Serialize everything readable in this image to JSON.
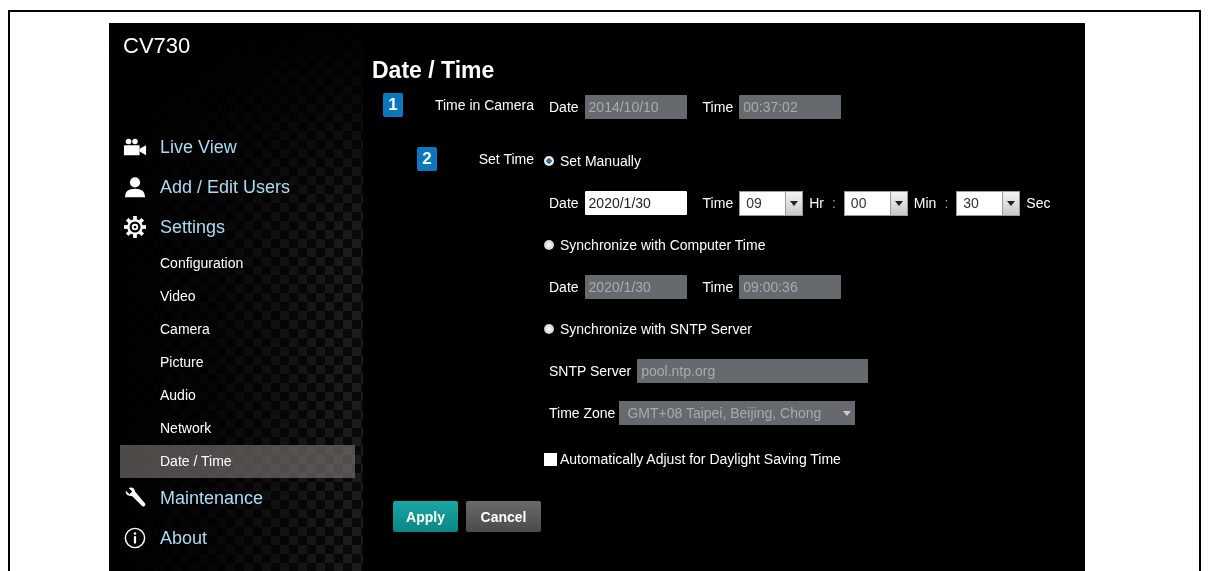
{
  "app": {
    "model": "CV730"
  },
  "sidebar": {
    "items": [
      {
        "label": "Live View"
      },
      {
        "label": "Add / Edit Users"
      },
      {
        "label": "Settings",
        "children": [
          {
            "label": "Configuration",
            "selected": false
          },
          {
            "label": "Video",
            "selected": false
          },
          {
            "label": "Camera",
            "selected": false
          },
          {
            "label": "Picture",
            "selected": false
          },
          {
            "label": "Audio",
            "selected": false
          },
          {
            "label": "Network",
            "selected": false
          },
          {
            "label": "Date / Time",
            "selected": true
          }
        ]
      },
      {
        "label": "Maintenance"
      },
      {
        "label": "About"
      }
    ]
  },
  "page": {
    "title": "Date / Time",
    "time_in_camera": {
      "number": "1",
      "label": "Time in Camera",
      "date_label": "Date",
      "date": "2014/10/10",
      "time_label": "Time",
      "time": "00:37:02"
    },
    "set_time": {
      "number": "2",
      "label": "Set Time",
      "options": [
        {
          "kind": "manual",
          "label": "Set Manually",
          "selected": true,
          "date_label": "Date",
          "date": "2020/1/30",
          "time_label": "Time",
          "time_parts": [
            {
              "value": "09",
              "unit": "Hr",
              "separator": ":"
            },
            {
              "value": "00",
              "unit": "Min",
              "separator": ":"
            },
            {
              "value": "30",
              "unit": "Sec"
            }
          ]
        },
        {
          "kind": "computer",
          "label": "Synchronize with Computer Time",
          "selected": false,
          "date_label": "Date",
          "date": "2020/1/30",
          "time_label": "Time",
          "time": "09:00:36"
        },
        {
          "kind": "sntp",
          "label": "Synchronize with SNTP Server",
          "selected": false,
          "server_label": "SNTP Server",
          "server": "pool.ntp.org",
          "zone_label": "Time Zone",
          "zone": "GMT+08 Taipei, Beijing, Chong"
        }
      ]
    },
    "daylight": {
      "label": "Automatically Adjust for Daylight Saving Time",
      "checked": false
    },
    "buttons": [
      {
        "label": "Apply",
        "kind": "primary"
      },
      {
        "label": "Cancel",
        "kind": "secondary"
      }
    ]
  }
}
